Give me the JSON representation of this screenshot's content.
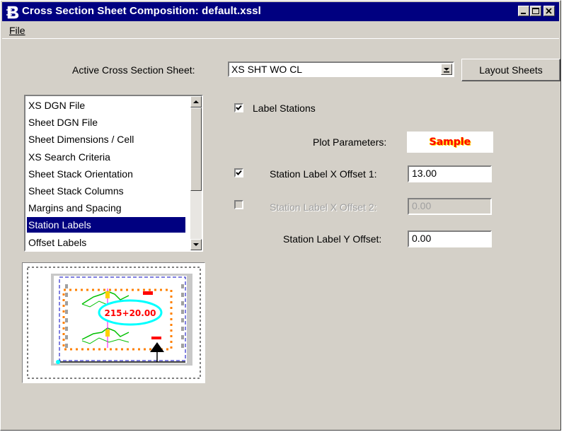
{
  "window": {
    "title": "Cross Section Sheet Composition: default.xssl",
    "minimize_icon": "minimize-icon",
    "maximize_icon": "maximize-icon",
    "close_icon": "close-icon",
    "app_icon": "bentley-b-icon"
  },
  "menu": {
    "file": "File"
  },
  "active_sheet": {
    "label": "Active Cross Section Sheet:",
    "value": "XS SHT WO CL",
    "dropdown_icon": "chevron-down-icon"
  },
  "layout_button": "Layout Sheets",
  "categories": {
    "items": [
      {
        "label": "XS DGN File"
      },
      {
        "label": "Sheet DGN File"
      },
      {
        "label": "Sheet Dimensions / Cell"
      },
      {
        "label": "XS Search Criteria"
      },
      {
        "label": "Sheet Stack Orientation"
      },
      {
        "label": "Sheet Stack Columns"
      },
      {
        "label": "Margins and Spacing"
      },
      {
        "label": "Station Labels"
      },
      {
        "label": "Offset Labels"
      }
    ],
    "selected": "Station Labels"
  },
  "preview": {
    "station_text": "215+20.00"
  },
  "label_stations": {
    "label": "Label Stations",
    "checked": true
  },
  "plot_parameters": {
    "label": "Plot Parameters:",
    "sample_text": "Sample"
  },
  "x_offset_1": {
    "label": "Station Label X Offset 1:",
    "value": "13.00",
    "checked": true
  },
  "x_offset_2": {
    "label": "Station Label X Offset 2:",
    "value": "0.00",
    "checked": false,
    "enabled": false
  },
  "y_offset": {
    "label": "Station Label Y Offset:",
    "value": "0.00"
  },
  "colors": {
    "title_bar": "#000080",
    "dialog_face": "#d4d0c8",
    "selection": "#000080",
    "sample_text": "#ff0000"
  }
}
